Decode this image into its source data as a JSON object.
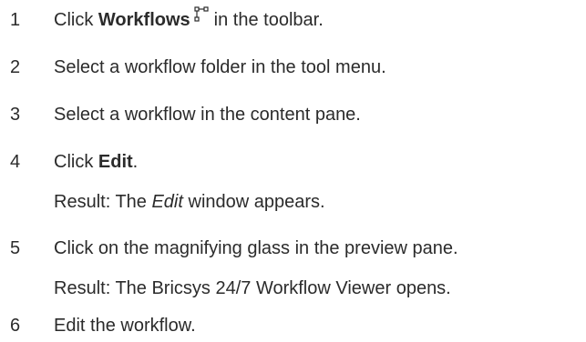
{
  "steps": [
    {
      "number": "1",
      "prefix": "Click ",
      "bold": "Workflows",
      "icon": "workflow-icon",
      "suffix": "in the toolbar."
    },
    {
      "number": "2",
      "text": "Select a workflow folder in the tool menu."
    },
    {
      "number": "3",
      "text": "Select a workflow in the content pane."
    },
    {
      "number": "4",
      "prefix": "Click ",
      "bold": "Edit",
      "suffix": ".",
      "result": {
        "prefix": "Result: The ",
        "italic": "Edit",
        "suffix": " window appears."
      }
    },
    {
      "number": "5",
      "text": "Click on the magnifying glass in the preview pane.",
      "result": {
        "text": "Result: The Bricsys 24/7 Workflow Viewer opens."
      }
    },
    {
      "number": "6",
      "text": "Edit the workflow."
    }
  ]
}
